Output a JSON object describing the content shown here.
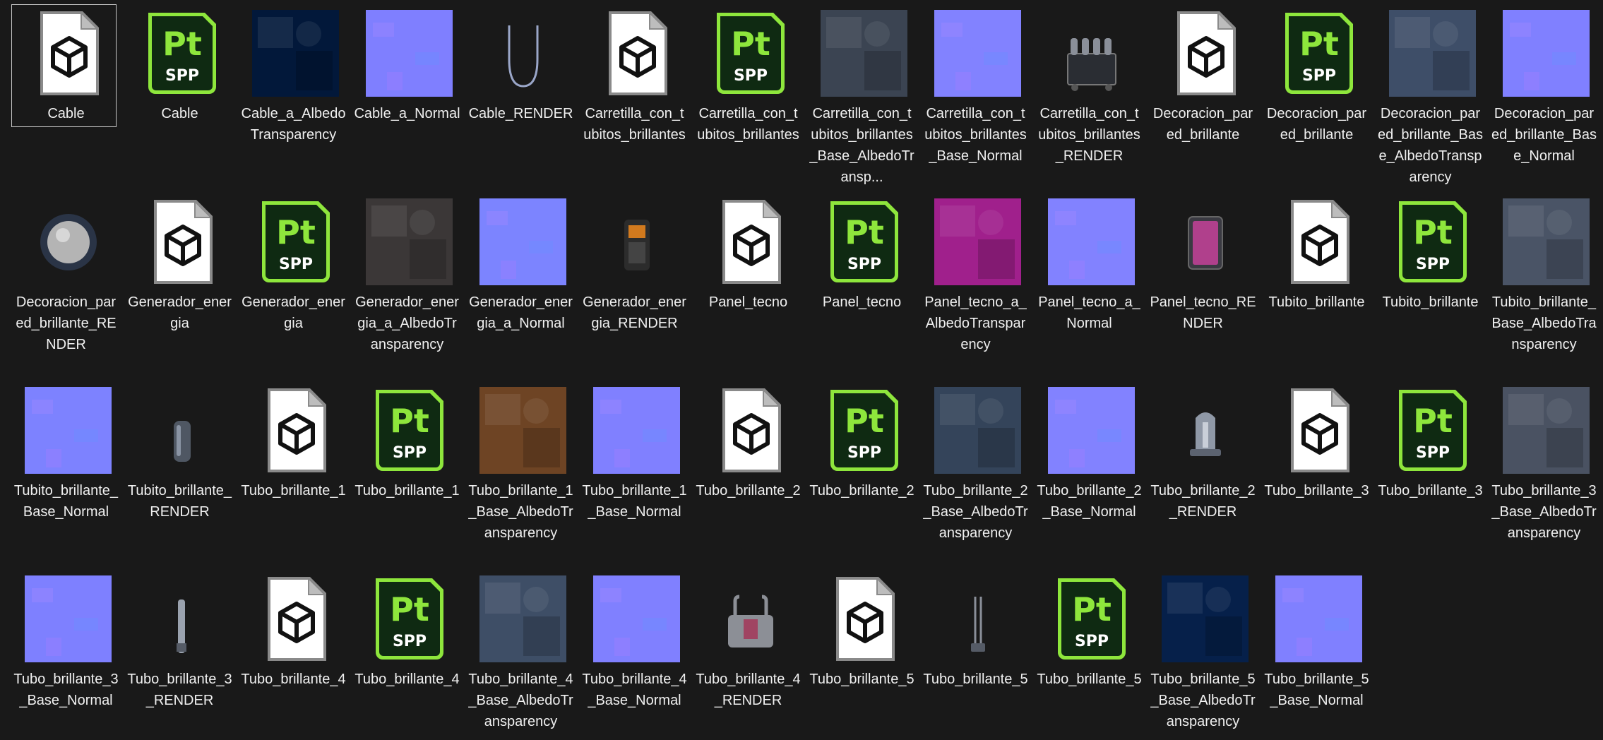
{
  "files": [
    {
      "name": "Cable",
      "kind": "model",
      "selected": true
    },
    {
      "name": "Cable",
      "kind": "spp"
    },
    {
      "name": "Cable_a_AlbedoTransparency",
      "kind": "albedo",
      "color": "#02183a"
    },
    {
      "name": "Cable_a_Normal",
      "kind": "normal",
      "color": "#7f7fff"
    },
    {
      "name": "Cable_RENDER",
      "kind": "render",
      "art": "cable"
    },
    {
      "name": "Carretilla_con_tubitos_brillantes",
      "kind": "model"
    },
    {
      "name": "Carretilla_con_tubitos_brillantes",
      "kind": "spp"
    },
    {
      "name": "Carretilla_con_tubitos_brillantes_Base_AlbedoTransp...",
      "kind": "albedo",
      "color": "#3b4452"
    },
    {
      "name": "Carretilla_con_tubitos_brillantes_Base_Normal",
      "kind": "normal",
      "color": "#8282ff"
    },
    {
      "name": "Carretilla_con_tubitos_brillantes_RENDER",
      "kind": "render",
      "art": "cart"
    },
    {
      "name": "Decoracion_pared_brillante",
      "kind": "model"
    },
    {
      "name": "Decoracion_pared_brillante",
      "kind": "spp"
    },
    {
      "name": "Decoracion_pared_brillante_Base_AlbedoTransparency",
      "kind": "albedo",
      "color": "#3e4e68"
    },
    {
      "name": "Decoracion_pared_brillante_Base_Normal",
      "kind": "normal",
      "color": "#8080ff"
    },
    {
      "name": "Decoracion_pared_brillante_RENDER",
      "kind": "render",
      "art": "dome"
    },
    {
      "name": "Generador_energia",
      "kind": "model"
    },
    {
      "name": "Generador_energia",
      "kind": "spp"
    },
    {
      "name": "Generador_energia_a_AlbedoTransparency",
      "kind": "albedo",
      "color": "#3b3737"
    },
    {
      "name": "Generador_energia_a_Normal",
      "kind": "normal",
      "color": "#7c84ff"
    },
    {
      "name": "Generador_energia_RENDER",
      "kind": "render",
      "art": "generator"
    },
    {
      "name": "Panel_tecno",
      "kind": "model"
    },
    {
      "name": "Panel_tecno",
      "kind": "spp"
    },
    {
      "name": "Panel_tecno_a_AlbedoTransparency",
      "kind": "albedo",
      "color": "#a0208c"
    },
    {
      "name": "Panel_tecno_a_Normal",
      "kind": "normal",
      "color": "#8282ff"
    },
    {
      "name": "Panel_tecno_RENDER",
      "kind": "render",
      "art": "panel"
    },
    {
      "name": "Tubito_brillante",
      "kind": "model"
    },
    {
      "name": "Tubito_brillante",
      "kind": "spp"
    },
    {
      "name": "Tubito_brillante_Base_AlbedoTransparency",
      "kind": "albedo",
      "color": "#4a5466"
    },
    {
      "name": "Tubito_brillante_Base_Normal",
      "kind": "normal",
      "color": "#7d82ff"
    },
    {
      "name": "Tubito_brillante_RENDER",
      "kind": "render",
      "art": "small-tube"
    },
    {
      "name": "Tubo_brillante_1",
      "kind": "model"
    },
    {
      "name": "Tubo_brillante_1",
      "kind": "spp"
    },
    {
      "name": "Tubo_brillante_1_Base_AlbedoTransparency",
      "kind": "albedo",
      "color": "#6e4424"
    },
    {
      "name": "Tubo_brillante_1_Base_Normal",
      "kind": "normal",
      "color": "#8080ff"
    },
    {
      "name": "Tubo_brillante_2",
      "kind": "model"
    },
    {
      "name": "Tubo_brillante_2",
      "kind": "spp"
    },
    {
      "name": "Tubo_brillante_2_Base_AlbedoTransparency",
      "kind": "albedo",
      "color": "#34445a"
    },
    {
      "name": "Tubo_brillante_2_Base_Normal",
      "kind": "normal",
      "color": "#8282ff"
    },
    {
      "name": "Tubo_brillante_2_RENDER",
      "kind": "render",
      "art": "capsule"
    },
    {
      "name": "Tubo_brillante_3",
      "kind": "model"
    },
    {
      "name": "Tubo_brillante_3",
      "kind": "spp"
    },
    {
      "name": "Tubo_brillante_3_Base_AlbedoTransparency",
      "kind": "albedo",
      "color": "#4a5262"
    },
    {
      "name": "Tubo_brillante_3_Base_Normal",
      "kind": "normal",
      "color": "#7e80ff"
    },
    {
      "name": "Tubo_brillante_3_RENDER",
      "kind": "render",
      "art": "rod"
    },
    {
      "name": "Tubo_brillante_4",
      "kind": "model"
    },
    {
      "name": "Tubo_brillante_4",
      "kind": "spp"
    },
    {
      "name": "Tubo_brillante_4_Base_AlbedoTransparency",
      "kind": "albedo",
      "color": "#3e4e66"
    },
    {
      "name": "Tubo_brillante_4_Base_Normal",
      "kind": "normal",
      "color": "#8080ff"
    },
    {
      "name": "Tubo_brillante_4_RENDER",
      "kind": "render",
      "art": "tank"
    },
    {
      "name": "Tubo_brillante_5",
      "kind": "model"
    },
    {
      "name": "Tubo_brillante_5",
      "kind": "render",
      "art": "stand"
    },
    {
      "name": "Tubo_brillante_5",
      "kind": "spp"
    },
    {
      "name": "Tubo_brillante_5_Base_AlbedoTransparency",
      "kind": "albedo",
      "color": "#06204a"
    },
    {
      "name": "Tubo_brillante_5_Base_Normal",
      "kind": "normal",
      "color": "#8080ff"
    }
  ],
  "icons": {
    "spp_text_top": "Pt",
    "spp_text_bottom": "SPP",
    "spp_accent": "#8ee63c",
    "spp_bg": "#0f2a12"
  }
}
